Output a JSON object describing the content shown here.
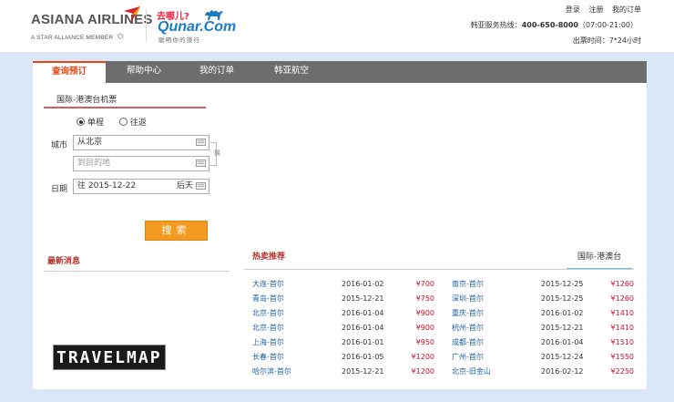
{
  "header": {
    "asiana_name": "ASIANA AIRLINES",
    "asiana_sub": "A STAR ALLIANCE MEMBER",
    "asiana_star": "✩",
    "qunar_cn": "去哪儿?",
    "qunar_en": "Qunar.Com",
    "qunar_slogan": "聪明你的旅行",
    "links": {
      "login": "登录",
      "register": "注册",
      "my_orders": "我的订单"
    },
    "hotline_label": "韩亚服务热线：",
    "hotline_number": "400-650-8000",
    "hotline_hours": "（07:00-21:00）",
    "service_time": "出票时间：7*24小时"
  },
  "nav": {
    "tabs": [
      "查询预订",
      "帮助中心",
      "我的订单",
      "韩亚航空"
    ]
  },
  "search": {
    "route_tab": "国际-港澳台机票",
    "trip_oneway": "单程",
    "trip_roundtrip": "往返",
    "city_label": "城市",
    "date_label": "日期",
    "from_value": "从北京",
    "to_placeholder": "到目的地",
    "date_value": "往 2015-12-22",
    "date_after": "后天",
    "swap_label": "换",
    "button": "搜索"
  },
  "news": {
    "title": "最新消息"
  },
  "watermark": "TRAVELMAP",
  "hot": {
    "title": "热卖推荐",
    "region_tab": "国际-港澳台",
    "left": [
      {
        "route": "大连-首尔",
        "date": "2016-01-02",
        "price": "¥700"
      },
      {
        "route": "青岛-首尔",
        "date": "2015-12-21",
        "price": "¥750"
      },
      {
        "route": "北京-首尔",
        "date": "2016-01-04",
        "price": "¥900"
      },
      {
        "route": "北京-首尔",
        "date": "2016-01-04",
        "price": "¥900"
      },
      {
        "route": "上海-首尔",
        "date": "2016-01-01",
        "price": "¥950"
      },
      {
        "route": "长春-首尔",
        "date": "2016-01-05",
        "price": "¥1200"
      },
      {
        "route": "哈尔滨-首尔",
        "date": "2015-12-21",
        "price": "¥1200"
      }
    ],
    "right": [
      {
        "route": "南京-首尔",
        "date": "2015-12-25",
        "price": "¥1260"
      },
      {
        "route": "深圳-首尔",
        "date": "2015-12-25",
        "price": "¥1260"
      },
      {
        "route": "重庆-首尔",
        "date": "2016-01-02",
        "price": "¥1410"
      },
      {
        "route": "杭州-首尔",
        "date": "2015-12-21",
        "price": "¥1410"
      },
      {
        "route": "成都-首尔",
        "date": "2016-01-04",
        "price": "¥1510"
      },
      {
        "route": "广州-首尔",
        "date": "2015-12-24",
        "price": "¥1550"
      },
      {
        "route": "北京-旧金山",
        "date": "2016-02-12",
        "price": "¥2250"
      }
    ]
  },
  "colors": {
    "accent_orange": "#f39a20",
    "price_red": "#c8102e",
    "link_blue": "#1a5ea8",
    "nav_gray": "#6d6d6d",
    "page_blue": "#dbe7f6"
  }
}
